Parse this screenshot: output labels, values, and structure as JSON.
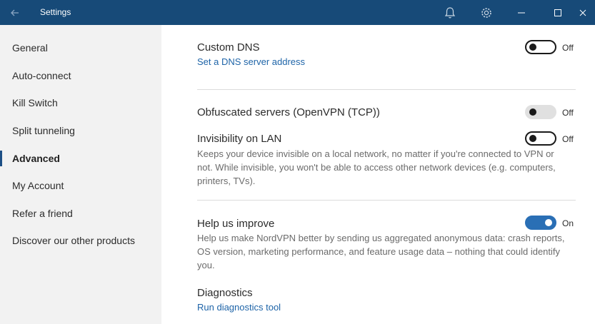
{
  "window": {
    "title": "Settings",
    "icons": {
      "back": "back-arrow-icon",
      "bell": "bell-icon",
      "gear": "gear-icon",
      "minimize": "minimize-icon",
      "maximize": "maximize-icon",
      "close": "close-icon"
    }
  },
  "sidebar": {
    "items": [
      {
        "label": "General"
      },
      {
        "label": "Auto-connect"
      },
      {
        "label": "Kill Switch"
      },
      {
        "label": "Split tunneling"
      },
      {
        "label": "Advanced",
        "active": true
      },
      {
        "label": "My Account"
      },
      {
        "label": "Refer a friend"
      },
      {
        "label": "Discover our other products"
      }
    ]
  },
  "settings": {
    "custom_dns": {
      "title": "Custom DNS",
      "link": "Set a DNS server address",
      "state": "Off"
    },
    "obfuscated": {
      "title": "Obfuscated servers (OpenVPN (TCP))",
      "state": "Off"
    },
    "invisibility": {
      "title": "Invisibility on LAN",
      "desc": "Keeps your device invisible on a local network, no matter if you're connected to VPN or not. While invisible, you won't be able to access other network devices (e.g. computers, printers, TVs).",
      "state": "Off"
    },
    "help_improve": {
      "title": "Help us improve",
      "desc": "Help us make NordVPN better by sending us aggregated anonymous data: crash reports, OS version, marketing performance, and feature usage data – nothing that could identify you.",
      "state": "On"
    },
    "diagnostics": {
      "title": "Diagnostics",
      "link": "Run diagnostics tool"
    }
  },
  "colors": {
    "titlebar": "#174a78",
    "accent": "#2a6fb5",
    "link": "#1e64a8"
  }
}
